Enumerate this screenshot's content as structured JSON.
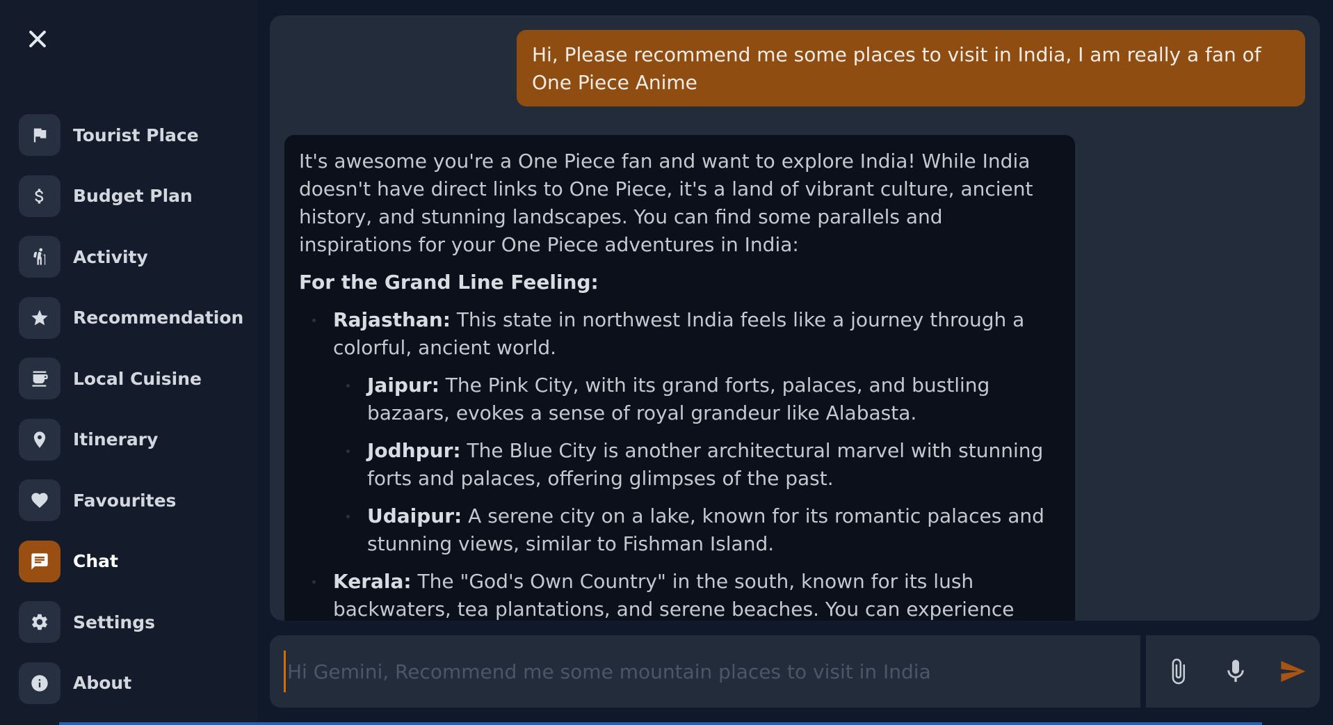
{
  "sidebar": {
    "items": [
      {
        "label": "Tourist Place",
        "icon": "flag-icon"
      },
      {
        "label": "Budget Plan",
        "icon": "dollar-icon"
      },
      {
        "label": "Activity",
        "icon": "hiking-icon"
      },
      {
        "label": "Recommendation",
        "icon": "star-icon"
      },
      {
        "label": "Local Cuisine",
        "icon": "coffee-icon"
      },
      {
        "label": "Itinerary",
        "icon": "location-pin-icon"
      },
      {
        "label": "Favourites",
        "icon": "heart-icon"
      },
      {
        "label": "Chat",
        "icon": "chat-icon",
        "active": true
      },
      {
        "label": "Settings",
        "icon": "gear-icon"
      },
      {
        "label": "About",
        "icon": "info-icon"
      }
    ]
  },
  "chat": {
    "user_message": "Hi, Please recommend me some places to visit in India, I am really a fan of One Piece Anime",
    "bot": {
      "intro": "It's awesome you're a One Piece fan and want to explore India! While India doesn't have direct links to One Piece, it's a land of vibrant culture, ancient history, and stunning landscapes. You can find some parallels and inspirations for your One Piece adventures in India:",
      "heading": "For the Grand Line Feeling:",
      "rajasthan_title": "Rajasthan:",
      "rajasthan_text": " This state in northwest India feels like a journey through a colorful, ancient world.",
      "jaipur_title": "Jaipur:",
      "jaipur_text": " The Pink City, with its grand forts, palaces, and bustling bazaars, evokes a sense of royal grandeur like Alabasta.",
      "jodhpur_title": "Jodhpur:",
      "jodhpur_text": " The Blue City is another architectural marvel with stunning forts and palaces, offering glimpses of the past.",
      "udaipur_title": "Udaipur:",
      "udaipur_text": " A serene city on a lake, known for its romantic palaces and stunning views, similar to Fishman Island.",
      "kerala_title": "Kerala:",
      "kerala_text": " The \"God's Own Country\" in the south, known for its lush backwaters, tea plantations, and serene beaches. You can experience"
    }
  },
  "input": {
    "placeholder": "Hi Gemini, Recommend me some mountain places to visit in India",
    "value": ""
  },
  "colors": {
    "accent": "#9a4f12",
    "user_bubble": "#8f4d12",
    "send_icon": "#a85414"
  }
}
